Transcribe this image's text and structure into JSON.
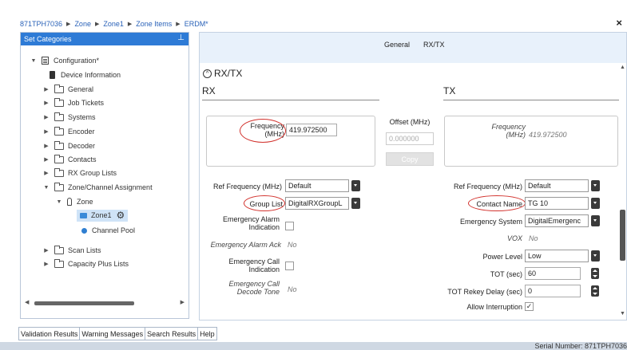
{
  "breadcrumb": [
    "871TPH7036",
    "Zone",
    "Zone1",
    "Zone Items",
    "ERDM*"
  ],
  "close_label": "×",
  "left_panel": {
    "title": "Set Categories",
    "tree": {
      "configuration": "Configuration*",
      "device_information": "Device Information",
      "general": "General",
      "job_tickets": "Job Tickets",
      "systems": "Systems",
      "encoder": "Encoder",
      "decoder": "Decoder",
      "contacts": "Contacts",
      "rx_group_lists": "RX Group Lists",
      "zone_channel_assignment": "Zone/Channel Assignment",
      "zone": "Zone",
      "zone1": "Zone1",
      "channel_pool": "Channel Pool",
      "scan_lists": "Scan Lists",
      "capacity_plus_lists": "Capacity Plus Lists"
    }
  },
  "right_panel": {
    "tabs": [
      "General",
      "RX/TX"
    ],
    "section_title": "RX/TX",
    "rx": {
      "heading": "RX",
      "frequency_label": "Frequency (MHz)",
      "frequency_value": "419.972500",
      "ref_frequency_label": "Ref Frequency (MHz)",
      "ref_frequency_value": "Default",
      "group_list_label": "Group List",
      "group_list_value": "DigitalRXGroupL",
      "emergency_alarm_indication_label": "Emergency Alarm Indication",
      "emergency_alarm_ack_label": "Emergency Alarm Ack",
      "emergency_alarm_ack_value": "No",
      "emergency_call_indication_label": "Emergency Call Indication",
      "emergency_call_decode_tone_label": "Emergency Call Decode Tone",
      "emergency_call_decode_tone_value": "No"
    },
    "offset": {
      "label": "Offset (MHz)",
      "value": "0.000000",
      "copy_label": "Copy"
    },
    "tx": {
      "heading": "TX",
      "frequency_label": "Frequency (MHz)",
      "frequency_value": "419.972500",
      "ref_frequency_label": "Ref Frequency (MHz)",
      "ref_frequency_value": "Default",
      "contact_name_label": "Contact Name",
      "contact_name_value": "TG 10",
      "emergency_system_label": "Emergency System",
      "emergency_system_value": "DigitalEmergenc",
      "vox_label": "VOX",
      "vox_value": "No",
      "power_level_label": "Power Level",
      "power_level_value": "Low",
      "tot_label": "TOT (sec)",
      "tot_value": "60",
      "tot_rekey_delay_label": "TOT Rekey Delay (sec)",
      "tot_rekey_delay_value": "0",
      "allow_interruption_label": "Allow Interruption",
      "allow_interruption_checked": "✓"
    }
  },
  "bottom_tabs": [
    "Validation Results",
    "Warning Messages",
    "Search Results",
    "Help"
  ],
  "status": {
    "serial_number": "Serial Number: 871TPH7036"
  },
  "colors": {
    "accent": "#2e7bd6",
    "highlight_ring": "#d2322d",
    "selected_row": "#cfe3f7",
    "tab_bar": "#e8f1fb"
  }
}
